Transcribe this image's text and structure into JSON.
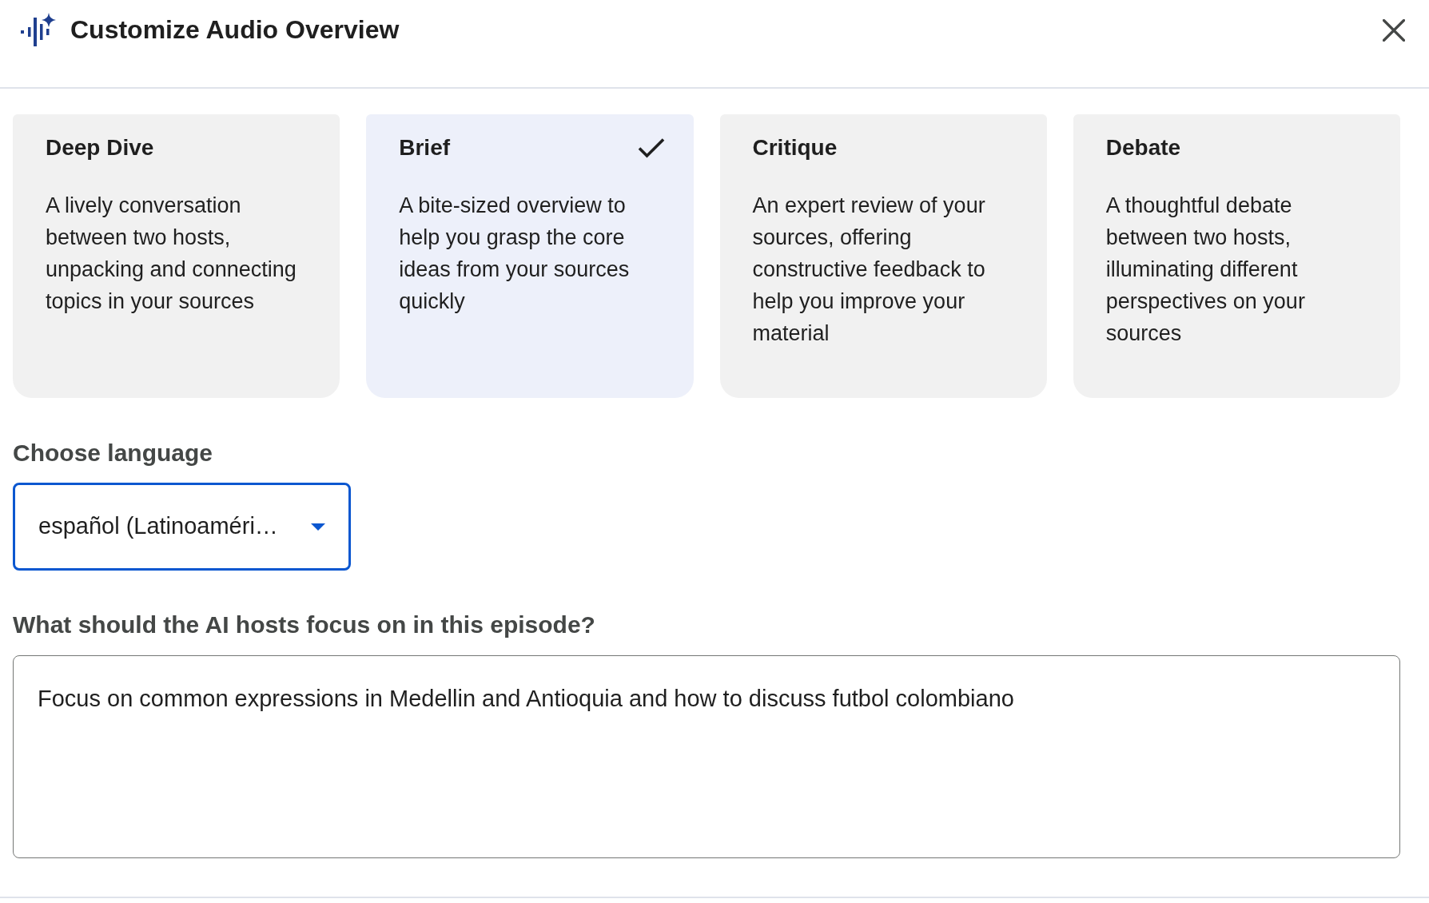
{
  "dialog": {
    "title": "Customize Audio Overview"
  },
  "formats": [
    {
      "title": "Deep Dive",
      "description": "A lively conversation between two hosts, unpacking and connecting topics in your sources",
      "selected": false
    },
    {
      "title": "Brief",
      "description": "A bite-sized overview to help you grasp the core ideas from your sources quickly",
      "selected": true
    },
    {
      "title": "Critique",
      "description": "An expert review of your sources, offering constructive feedback to help you improve your material",
      "selected": false
    },
    {
      "title": "Debate",
      "description": "A thoughtful debate between two hosts, illuminating different perspectives on your sources",
      "selected": false
    }
  ],
  "language": {
    "label": "Choose language",
    "value": "español (Latinoaméri…",
    "focused": true
  },
  "focus": {
    "label": "What should the AI hosts focus on in this episode?",
    "value": "Focus on common expressions in Medellin and Antioquia and how to discuss futbol colombiano"
  }
}
